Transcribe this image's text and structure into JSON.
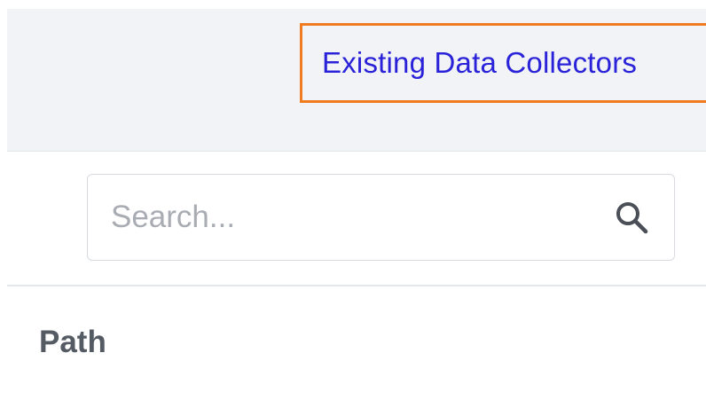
{
  "tabs": {
    "active_label": "Existing Data Collectors",
    "active_border_color": "#f07c22",
    "label_color": "#2a22d8"
  },
  "search": {
    "placeholder": "Search...",
    "value": "",
    "icon": "search-icon"
  },
  "table": {
    "columns": [
      "Path"
    ]
  }
}
